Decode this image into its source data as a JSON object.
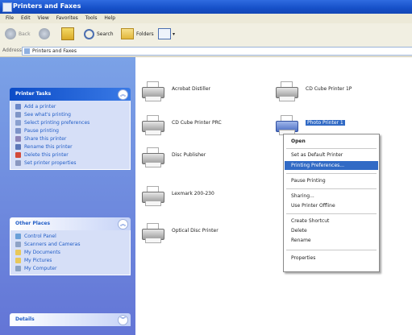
{
  "window": {
    "title": "Printers and Faxes"
  },
  "menu": [
    "File",
    "Edit",
    "View",
    "Favorites",
    "Tools",
    "Help"
  ],
  "toolbar": {
    "back": "Back",
    "search": "Search",
    "folders": "Folders"
  },
  "address": {
    "label": "Address",
    "value": "Printers and Faxes"
  },
  "tasks_panel": {
    "title": "Printer Tasks",
    "items": [
      {
        "label": "Add a printer",
        "icon": "printer-add-icon",
        "color": "#6b88c9"
      },
      {
        "label": "See what's printing",
        "icon": "printer-queue-icon",
        "color": "#7f95c7"
      },
      {
        "label": "Select printing preferences",
        "icon": "preferences-icon",
        "color": "#8aa0cf"
      },
      {
        "label": "Pause printing",
        "icon": "pause-icon",
        "color": "#7d93c8"
      },
      {
        "label": "Share this printer",
        "icon": "share-icon",
        "color": "#8c84b8"
      },
      {
        "label": "Rename this printer",
        "icon": "rename-icon",
        "color": "#5c77b8"
      },
      {
        "label": "Delete this printer",
        "icon": "delete-icon",
        "color": "#d24a3a"
      },
      {
        "label": "Set printer properties",
        "icon": "properties-icon",
        "color": "#8a98c0"
      }
    ]
  },
  "places_panel": {
    "title": "Other Places",
    "items": [
      {
        "label": "Control Panel",
        "icon": "control-panel-icon",
        "color": "#6aa0d8"
      },
      {
        "label": "Scanners and Cameras",
        "icon": "scanner-icon",
        "color": "#8ea3c6"
      },
      {
        "label": "My Documents",
        "icon": "folder-icon",
        "color": "#e8c85a"
      },
      {
        "label": "My Pictures",
        "icon": "folder-icon",
        "color": "#e8c85a"
      },
      {
        "label": "My Computer",
        "icon": "computer-icon",
        "color": "#8aa2c4"
      }
    ]
  },
  "details_panel": {
    "title": "Details"
  },
  "printers": [
    {
      "name": "Acrobat Distiller",
      "selected": false
    },
    {
      "name": "CD Cube Printer 1P",
      "selected": false
    },
    {
      "name": "CD Cube Printer PRC",
      "selected": false
    },
    {
      "name": "Photo Printer 1",
      "selected": true
    },
    {
      "name": "Disc Publisher",
      "selected": false
    },
    {
      "name": "Lexmark 200-230",
      "selected": false
    },
    {
      "name": "Optical Disc Printer",
      "selected": false
    }
  ],
  "context_menu": {
    "items": [
      {
        "label": "Open",
        "bold": true
      },
      {
        "label": "Set as Default Printer"
      },
      {
        "label": "Printing Preferences...",
        "highlighted": true
      },
      {
        "label": "Pause Printing"
      },
      {
        "label": "Sharing..."
      },
      {
        "label": "Use Printer Offline"
      },
      {
        "label": "Create Shortcut"
      },
      {
        "label": "Delete"
      },
      {
        "label": "Rename"
      },
      {
        "label": "Properties"
      }
    ]
  }
}
